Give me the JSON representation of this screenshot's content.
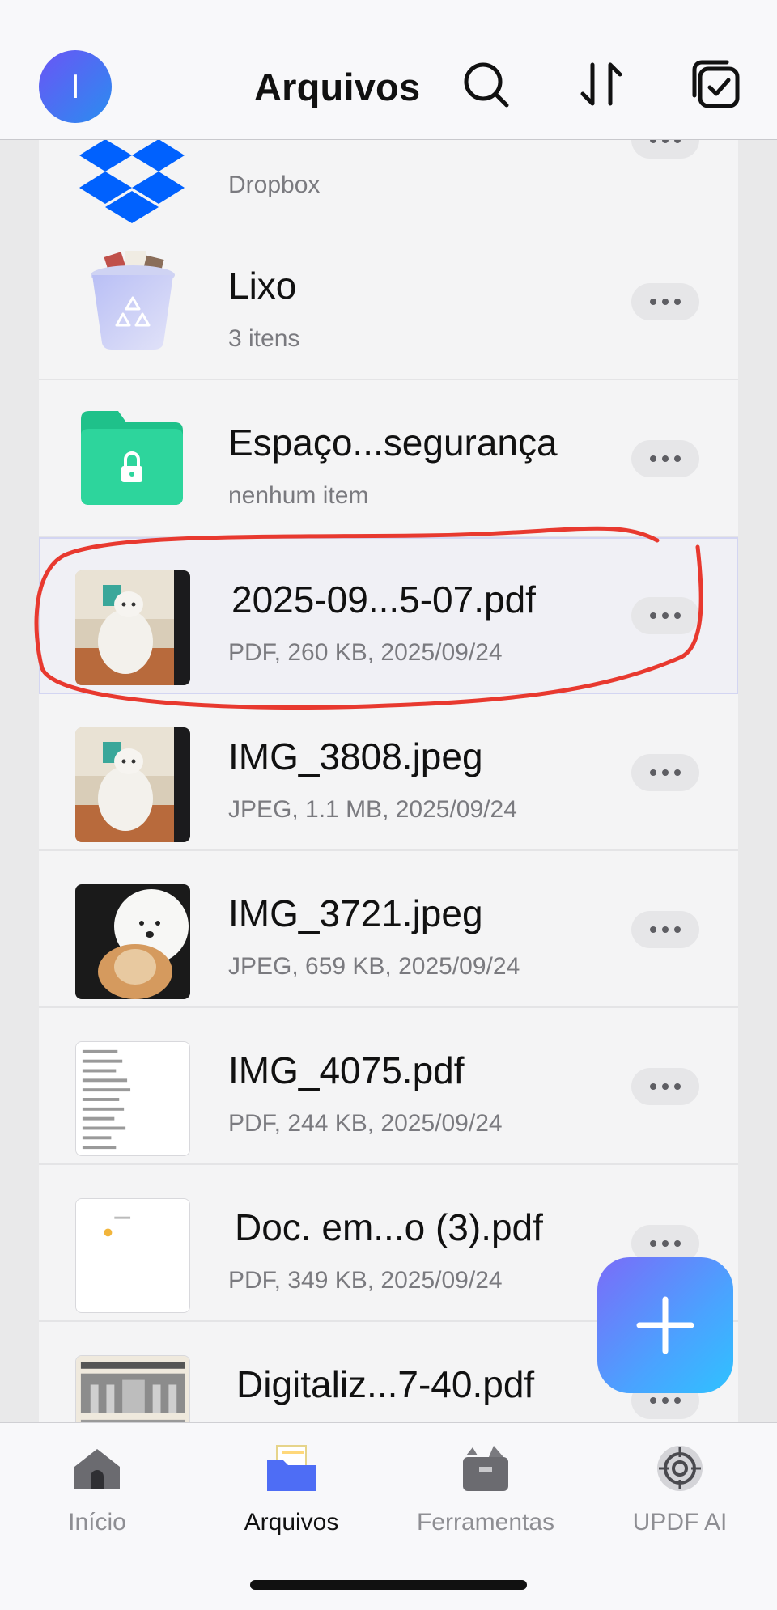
{
  "header": {
    "avatar_initial": "I",
    "title": "Arquivos",
    "icons": [
      "search-icon",
      "sort-icon",
      "select-icon"
    ]
  },
  "files": [
    {
      "name": "",
      "meta": "Dropbox",
      "icon": "dropbox-icon"
    },
    {
      "name": "Lixo",
      "meta": "3 itens",
      "icon": "trash-icon"
    },
    {
      "name": "Espaço...segurança",
      "meta": "nenhum item",
      "icon": "locked-folder-icon"
    },
    {
      "name": "2025-09...5-07.pdf",
      "meta": "PDF, 260 KB, 2025/09/24",
      "icon": "cat-photo-thumbnail",
      "selected": true
    },
    {
      "name": "IMG_3808.jpeg",
      "meta": "JPEG, 1.1 MB, 2025/09/24",
      "icon": "cat-photo-thumbnail"
    },
    {
      "name": "IMG_3721.jpeg",
      "meta": "JPEG, 659 KB, 2025/09/24",
      "icon": "dog-cat-photo-thumbnail"
    },
    {
      "name": "IMG_4075.pdf",
      "meta": "PDF, 244 KB, 2025/09/24",
      "icon": "text-document-thumbnail"
    },
    {
      "name": "Doc. em...o (3).pdf",
      "meta": "PDF, 349 KB, 2025/09/24",
      "icon": "blank-document-thumbnail"
    },
    {
      "name": "Digitaliz...7-40.pdf",
      "meta": "",
      "icon": "newspaper-thumbnail"
    }
  ],
  "tabs": [
    {
      "label": "Início",
      "icon": "home-icon"
    },
    {
      "label": "Arquivos",
      "icon": "folder-icon",
      "active": true
    },
    {
      "label": "Ferramentas",
      "icon": "toolbox-icon"
    },
    {
      "label": "UPDF AI",
      "icon": "ai-icon"
    }
  ],
  "fab": {
    "icon": "plus-icon"
  },
  "colors": {
    "accent": "#4a7cf5",
    "annotation": "#e8392f",
    "selected_outline": "#d3d5f2"
  }
}
